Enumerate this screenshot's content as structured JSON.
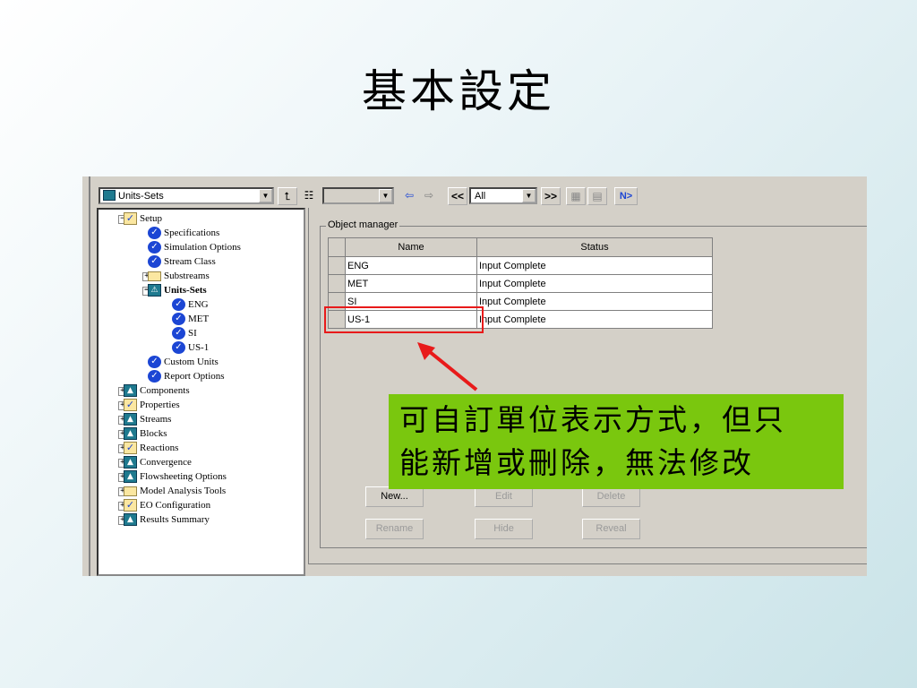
{
  "slide": {
    "title": "基本設定"
  },
  "toolbar": {
    "combo_units": "Units-Sets",
    "combo_filter": "All",
    "prev_label": "<<",
    "next_label": ">>",
    "next_btn_label": "N>"
  },
  "tree": {
    "items": [
      {
        "label": "Setup",
        "icon": "folder-check-icon",
        "level": 0,
        "expander": "−"
      },
      {
        "label": "Specifications",
        "icon": "check-circle-icon",
        "level": 1
      },
      {
        "label": "Simulation Options",
        "icon": "check-circle-icon",
        "level": 1
      },
      {
        "label": "Stream Class",
        "icon": "check-circle-icon",
        "level": 1
      },
      {
        "label": "Substreams",
        "icon": "folder-icon",
        "level": 1,
        "expander": "+"
      },
      {
        "label": "Units-Sets",
        "icon": "folder-open-icon",
        "level": 1,
        "expander": "−",
        "bold": true
      },
      {
        "label": "ENG",
        "icon": "check-circle-icon",
        "level": 2
      },
      {
        "label": "MET",
        "icon": "check-circle-icon",
        "level": 2
      },
      {
        "label": "SI",
        "icon": "check-circle-icon",
        "level": 2
      },
      {
        "label": "US-1",
        "icon": "check-circle-icon",
        "level": 2
      },
      {
        "label": "Custom Units",
        "icon": "check-circle-icon",
        "level": 1
      },
      {
        "label": "Report Options",
        "icon": "check-circle-icon",
        "level": 1
      },
      {
        "label": "Components",
        "icon": "triangle-folder-icon",
        "level": 0,
        "expander": "+"
      },
      {
        "label": "Properties",
        "icon": "folder-check-icon",
        "level": 0,
        "expander": "+"
      },
      {
        "label": "Streams",
        "icon": "triangle-folder-icon",
        "level": 0,
        "expander": "+"
      },
      {
        "label": "Blocks",
        "icon": "triangle-folder-icon",
        "level": 0,
        "expander": "+"
      },
      {
        "label": "Reactions",
        "icon": "folder-check-icon",
        "level": 0,
        "expander": "+"
      },
      {
        "label": "Convergence",
        "icon": "triangle-folder-icon",
        "level": 0,
        "expander": "+"
      },
      {
        "label": "Flowsheeting Options",
        "icon": "triangle-folder-icon",
        "level": 0,
        "expander": "+"
      },
      {
        "label": "Model Analysis Tools",
        "icon": "folder-icon",
        "level": 0,
        "expander": "+"
      },
      {
        "label": "EO Configuration",
        "icon": "folder-check-icon",
        "level": 0,
        "expander": "+"
      },
      {
        "label": "Results Summary",
        "icon": "triangle-folder-icon",
        "level": 0,
        "expander": "+"
      }
    ]
  },
  "object_manager": {
    "group_label": "Object manager",
    "columns": [
      "Name",
      "Status"
    ],
    "rows": [
      {
        "name": "ENG",
        "status": "Input Complete"
      },
      {
        "name": "MET",
        "status": "Input Complete"
      },
      {
        "name": "SI",
        "status": "Input Complete"
      },
      {
        "name": "US-1",
        "status": "Input Complete"
      }
    ],
    "buttons": {
      "new": "New...",
      "edit": "Edit",
      "delete": "Delete",
      "rename": "Rename",
      "hide": "Hide",
      "reveal": "Reveal"
    }
  },
  "annotation": {
    "line1": "可自訂單位表示方式，但只",
    "line2": "能新增或刪除，無法修改",
    "highlight_color": "#e81a1a",
    "callout_color": "#7ac70e"
  }
}
